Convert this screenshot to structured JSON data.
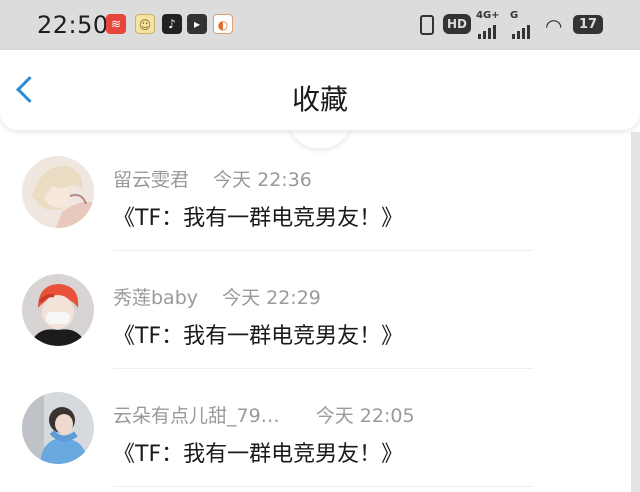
{
  "status_bar": {
    "time": "22:50",
    "notifications": [
      "app-icon-red",
      "app-icon-yellow",
      "tiktok-icon",
      "app-icon-dark",
      "app-icon-orange"
    ],
    "hd_label": "HD",
    "network_label": "4G+",
    "network_label_2": "G",
    "battery_level": "17"
  },
  "header": {
    "title": "收藏",
    "back_icon": "chevron-left-icon"
  },
  "items": [
    {
      "name": "留云雯君",
      "date": "今天",
      "time": "22:36",
      "content": "《TF：我有一群电竞男友！》"
    },
    {
      "name": "秀莲baby",
      "date": "今天",
      "time": "22:29",
      "content": "《TF：我有一群电竞男友！》"
    },
    {
      "name": "云朵有点儿甜_79…",
      "date": "今天",
      "time": "22:05",
      "content": "《TF：我有一群电竞男友！》"
    }
  ],
  "colors": {
    "accent": "#2a8bd6",
    "status_bar_bg": "#dcdcdc",
    "meta_text": "#9a9a9a"
  }
}
